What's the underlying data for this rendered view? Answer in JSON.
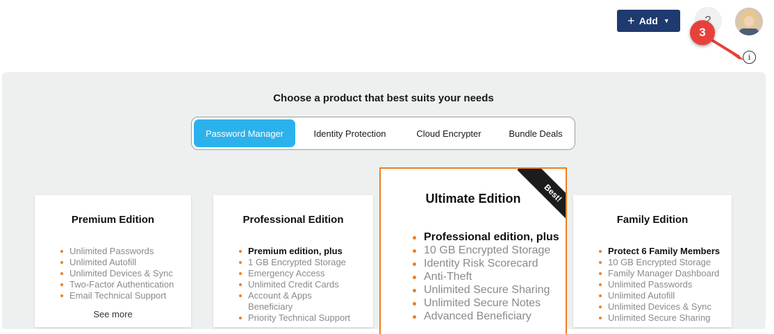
{
  "header": {
    "add_label": "Add",
    "help_label": "?",
    "badge_number": "3",
    "info_label": "i"
  },
  "main": {
    "headline": "Choose a product that best suits your needs",
    "tabs": [
      {
        "label": "Password Manager",
        "active": true
      },
      {
        "label": "Identity Protection",
        "active": false
      },
      {
        "label": "Cloud Encrypter",
        "active": false
      },
      {
        "label": "Bundle Deals",
        "active": false
      }
    ]
  },
  "cards": {
    "premium": {
      "title": "Premium Edition",
      "features": [
        "Unlimited Passwords",
        "Unlimited Autofill",
        "Unlimited Devices & Sync",
        "Two-Factor Authentication",
        "Email Technical Support"
      ],
      "see_more": "See more"
    },
    "professional": {
      "title": "Professional Edition",
      "features": [
        "Premium edition, plus",
        "1 GB Encrypted Storage",
        "Emergency Access",
        "Unlimited Credit Cards",
        "Account & Apps",
        "Beneficiary",
        "Priority Technical Support"
      ]
    },
    "ultimate": {
      "title": "Ultimate Edition",
      "ribbon": "Best!",
      "features": [
        "Professional edition, plus",
        "10 GB Encrypted Storage",
        "Identity Risk Scorecard",
        "Anti-Theft",
        "Unlimited Secure Sharing",
        "Unlimited Secure Notes",
        "Advanced Beneficiary"
      ]
    },
    "family": {
      "title": "Family Edition",
      "features": [
        "Protect 6 Family Members",
        "10 GB Encrypted Storage",
        "Family Manager Dashboard",
        "Unlimited Passwords",
        "Unlimited Autofill",
        "Unlimited Devices & Sync",
        "Unlimited Secure Sharing"
      ]
    }
  },
  "colors": {
    "primary_button": "#1f3a6e",
    "active_tab": "#2bb2ec",
    "accent_orange": "#ef7d20",
    "badge_red": "#e8413b"
  }
}
